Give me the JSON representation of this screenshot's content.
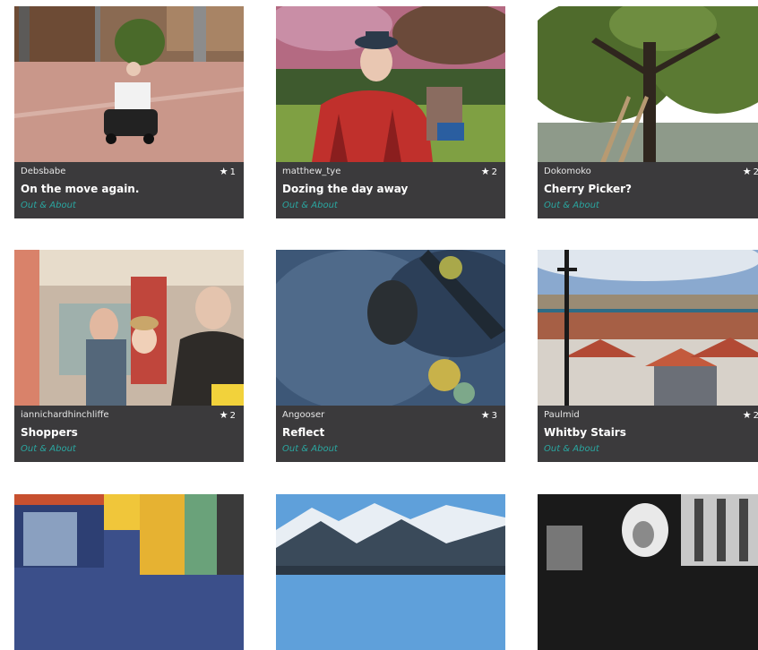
{
  "cards": [
    {
      "user": "Debsbabe",
      "stars": "1",
      "title": "On the move again.",
      "category": "Out & About",
      "image": "man-on-mobility-scooter"
    },
    {
      "user": "matthew_tye",
      "stars": "2",
      "title": "Dozing the day away",
      "category": "Out & About",
      "image": "man-in-plaid-blanket"
    },
    {
      "user": "Dokomoko",
      "stars": "2",
      "title": "Cherry Picker?",
      "category": "Out & About",
      "image": "tree-and-river"
    },
    {
      "user": "iannichardhinchliffe",
      "stars": "2",
      "title": "Shoppers",
      "category": "Out & About",
      "image": "shoppers-in-store"
    },
    {
      "user": "Angooser",
      "stars": "3",
      "title": "Reflect",
      "category": "Out & About",
      "image": "reflection-in-water"
    },
    {
      "user": "Paulmid",
      "stars": "2",
      "title": "Whitby Stairs",
      "category": "Out & About",
      "image": "whitby-harbour-town"
    },
    {
      "image": "shop-front"
    },
    {
      "image": "snowy-mountains"
    },
    {
      "image": "black-and-white-portrait"
    }
  ],
  "icons": {
    "star": "star-icon"
  }
}
